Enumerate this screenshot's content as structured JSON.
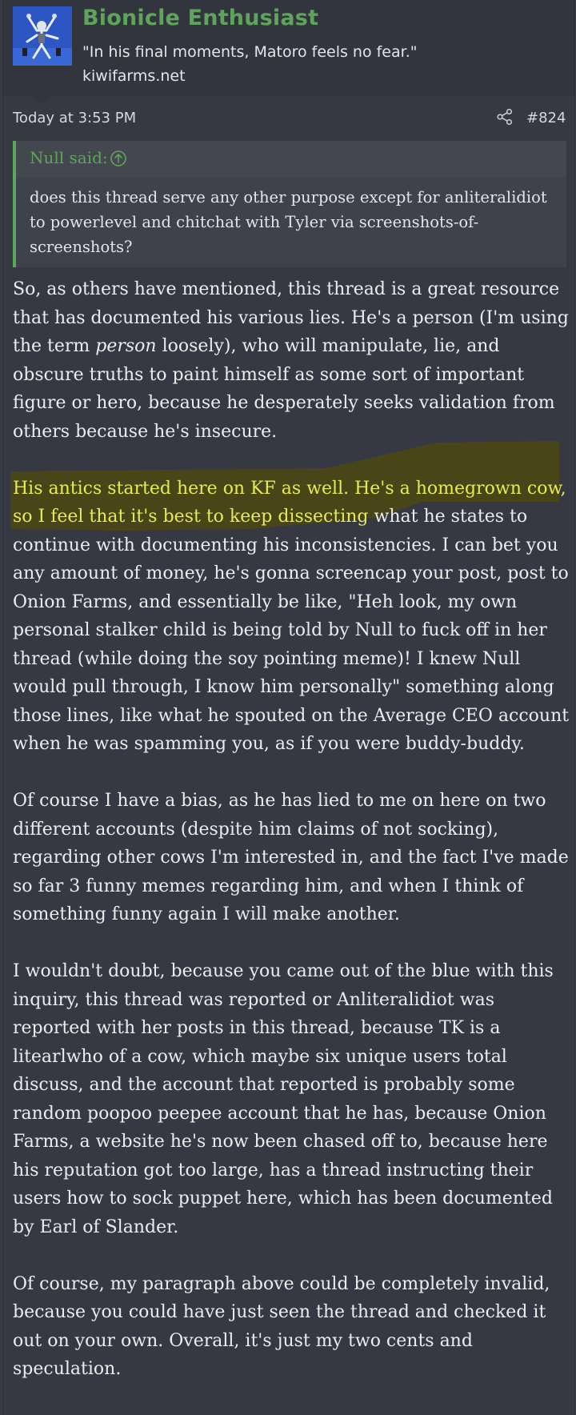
{
  "user": {
    "name": "Bionicle Enthusiast",
    "title": "\"In his final moments, Matoro feels no fear.\"",
    "site": "kiwifarms.net",
    "avatar_icon": "bionicle-figure-avatar"
  },
  "post": {
    "timestamp": "Today at 3:53 PM",
    "share_icon": "share-icon",
    "number": "#824"
  },
  "quote": {
    "author": "Null said:",
    "jump_icon": "arrow-up-circle-icon",
    "text": "does this thread serve any other purpose except for anliteralidiot to powerlevel and chitchat with Tyler via screenshots-of-screenshots?"
  },
  "body": {
    "p1_a": "So, as others have mentioned, this thread is a great resource that has documented his various lies. He's a person (I'm using the term ",
    "p1_em": "person",
    "p1_b": " loosely), who will manipulate, lie, and obscure truths to paint himself as some sort of important figure or hero, because he desperately seeks validation from others because he's insecure.",
    "p2_highlighted": "His antics started here on KF as well. He's a homegrown cow, so I feel that it's best to keep dissecting",
    "p2_rest": " what he states to continue with documenting his inconsistencies. I can bet you any amount of money, he's gonna screencap your post, post to Onion Farms, and essentially be like, \"Heh look, my own personal stalker child is being told by Null to fuck off in her thread (while doing the soy pointing meme)! I knew Null would pull through, I know him personally\" something along those lines, like what he spouted on the Average CEO account when he was spamming you, as if you were buddy-buddy.",
    "p3": "Of course I have a bias, as he has lied to me on here on two different accounts (despite him claims of not socking), regarding other cows I'm interested in, and the fact I've made so far 3 funny memes regarding him, and when I think of something funny again I will make another.",
    "p4": "I wouldn't doubt, because you came out of the blue with this inquiry, this thread was reported or Anliteralidiot was reported with her posts in this thread, because TK is a litearlwho of a cow, which maybe six unique users total discuss, and the account that reported is probably some random poopoo peepee account that he has, because Onion Farms, a website he's now been chased off to, because here his reputation got too large, has a thread instructing their users how to sock puppet here, which has been documented by Earl of Slander.",
    "p5": "Of course, my paragraph above could be completely invalid, because you could have just seen the thread and checked it out on your own. Overall, it's just my two cents and speculation."
  },
  "colors": {
    "accent_green": "#5ea45a",
    "highlight_text": "#e6ea56",
    "highlight_marker": "#4a4717"
  }
}
